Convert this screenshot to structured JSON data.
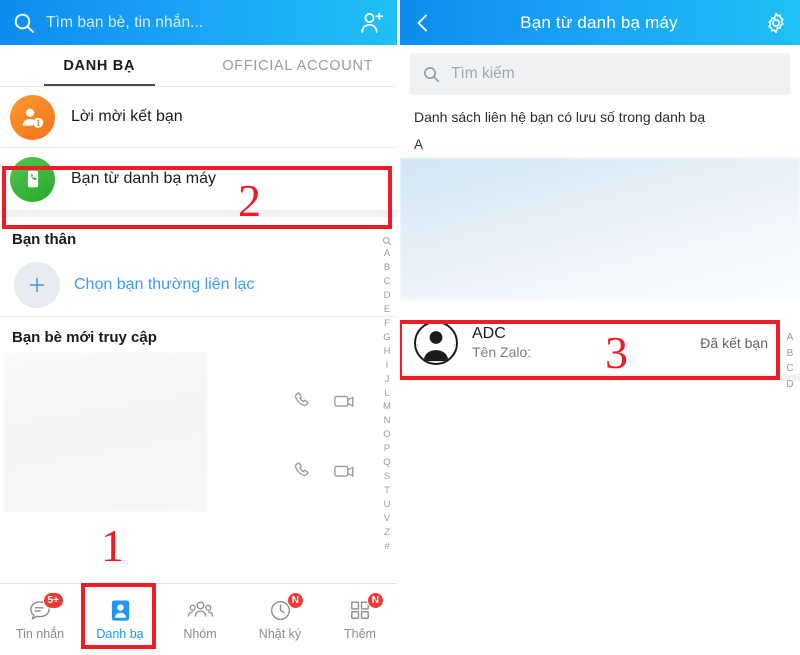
{
  "left_panel": {
    "header": {
      "search_placeholder": "Tìm bạn bè, tin nhắn...",
      "search_icon": "search-icon",
      "add_friend_icon": "add-friend-icon"
    },
    "tabs": [
      {
        "label": "DANH BẠ",
        "active": true
      },
      {
        "label": "OFFICIAL ACCOUNT",
        "active": false
      }
    ],
    "rows": [
      {
        "label": "Lời mời kết bạn",
        "icon": "friend-request-icon"
      },
      {
        "label": "Bạn từ danh bạ máy",
        "icon": "phonebook-icon"
      }
    ],
    "best_friends": {
      "title": "Bạn thân",
      "choose_label": "Chọn bạn thường liên lạc",
      "plus_icon": "plus-icon"
    },
    "recent": {
      "title": "Bạn bè mới truy cập",
      "call_icon": "phone-call-icon",
      "video_icon": "video-call-icon"
    },
    "alpha_index": [
      "A",
      "B",
      "C",
      "D",
      "E",
      "F",
      "G",
      "H",
      "I",
      "J",
      "L",
      "M",
      "N",
      "O",
      "P",
      "Q",
      "S",
      "T",
      "U",
      "V",
      "Z",
      "#"
    ],
    "alpha_index_magnifier": "search-icon",
    "bottom_nav": [
      {
        "label": "Tin nhắn",
        "icon": "chat-bubble-icon",
        "badge": "5+",
        "active": false
      },
      {
        "label": "Danh bạ",
        "icon": "contacts-icon",
        "badge": "",
        "active": true
      },
      {
        "label": "Nhóm",
        "icon": "group-icon",
        "badge": "",
        "active": false
      },
      {
        "label": "Nhật ký",
        "icon": "clock-icon",
        "badge": "N",
        "active": false
      },
      {
        "label": "Thêm",
        "icon": "grid-more-icon",
        "badge": "N",
        "active": false
      }
    ]
  },
  "right_panel": {
    "header": {
      "back_icon": "back-arrow-icon",
      "title": "Bạn từ danh bạ máy",
      "settings_icon": "gear-icon"
    },
    "search": {
      "placeholder": "Tìm kiếm",
      "icon": "search-icon"
    },
    "list_note": "Danh sách liên hệ bạn có lưu số trong danh bạ",
    "section_letter": "A",
    "contact": {
      "name": "ADC",
      "subtitle": "Tên Zalo:",
      "status": "Đã kết bạn",
      "avatar_icon": "person-avatar-icon"
    },
    "alpha_index": [
      "A",
      "B",
      "C",
      "D"
    ]
  },
  "callouts": [
    {
      "number": "1"
    },
    {
      "number": "2"
    },
    {
      "number": "3"
    }
  ],
  "colors": {
    "header_blue_start": "#0d8df0",
    "header_blue_end": "#1fc0f7",
    "accent_blue": "#2196f3",
    "callout_red": "#ee1c25",
    "badge_red": "#ee3b35",
    "orange": "#f4711e",
    "green": "#29a829"
  }
}
